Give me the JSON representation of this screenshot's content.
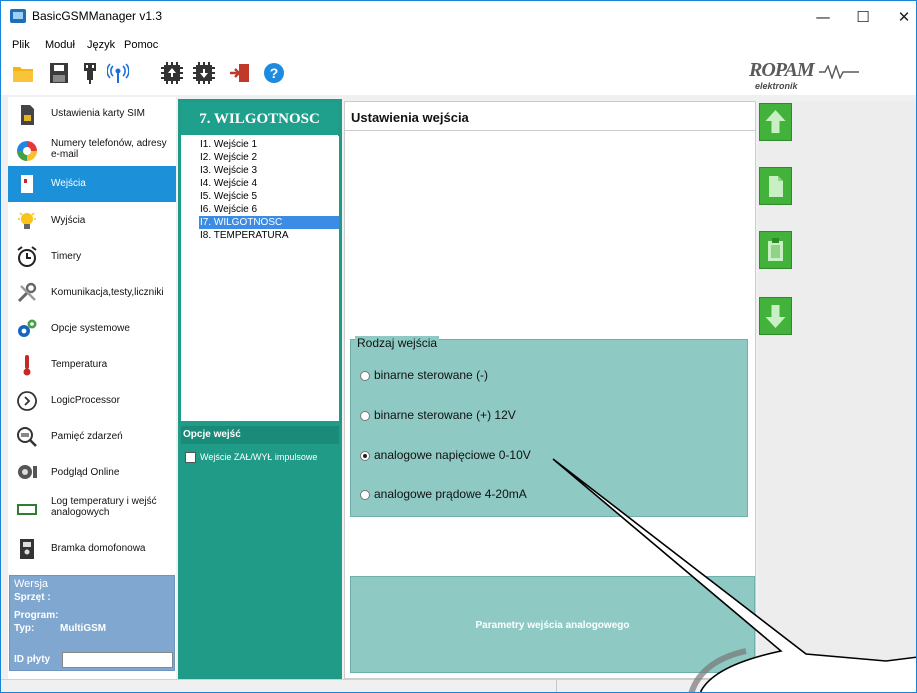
{
  "window": {
    "title": "BasicGSMManager v1.3",
    "controls": [
      "—",
      "☐",
      "✕"
    ]
  },
  "menu": [
    "Plik",
    "Moduł",
    "Język",
    "Pomoc"
  ],
  "toolbar": {
    "icons": [
      "folder-open-icon",
      "save-icon",
      "usb-plug-icon",
      "antenna-icon",
      "chip-upload-icon",
      "chip-download-icon",
      "exit-door-icon",
      "help-icon"
    ],
    "help_glyph": "?",
    "logo_main": "ROPAM",
    "logo_sub": "elektronik"
  },
  "sidebar": {
    "items": [
      {
        "label": "Ustawienia karty SIM",
        "icon": "sim-card-icon",
        "active": false
      },
      {
        "label": "Numery telefonów, adresy e-mail",
        "icon": "contacts-icon",
        "active": false
      },
      {
        "label": "Wejścia",
        "icon": "input-icon",
        "active": true
      },
      {
        "label": "Wyjścia",
        "icon": "bulb-icon",
        "active": false
      },
      {
        "label": "Timery",
        "icon": "alarm-clock-icon",
        "active": false
      },
      {
        "label": "Komunikacja,testy,liczniki",
        "icon": "tools-icon",
        "active": false
      },
      {
        "label": "Opcje systemowe",
        "icon": "gears-icon",
        "active": false
      },
      {
        "label": "Temperatura",
        "icon": "thermometer-icon",
        "active": false
      },
      {
        "label": "LogicProcessor",
        "icon": "brain-icon",
        "active": false
      },
      {
        "label": "Pamięć zdarzeń",
        "icon": "event-memory-icon",
        "active": false
      },
      {
        "label": "Podgląd Online",
        "icon": "online-preview-icon",
        "active": false
      },
      {
        "label": "Log temperatury i wejść analogowych",
        "icon": "log-icon",
        "active": false
      },
      {
        "label": "Bramka domofonowa",
        "icon": "intercom-icon",
        "active": false
      }
    ],
    "version": {
      "legend": "Wersja",
      "hardware_label": "Sprzęt :",
      "program_label": "Program:",
      "type_label": "Typ:",
      "type_value": "MultiGSM",
      "board_id_label": "ID płyty",
      "board_id_value": ""
    }
  },
  "inputs_panel": {
    "header": "7. WILGOTNOSC",
    "items": [
      "I1. Wejście 1",
      "I2. Wejście 2",
      "I3. Wejście 3",
      "I4. Wejście 4",
      "I5. Wejście 5",
      "I6. Wejście 6",
      "I7. WILGOTNOSC",
      "I8. TEMPERATURA"
    ],
    "selected_index": 6,
    "options_header": "Opcje wejść",
    "impulse_checkbox": {
      "label": "Wejście ZAŁ/WYŁ impulsowe",
      "checked": false
    }
  },
  "settings": {
    "title": "Ustawienia wejścia",
    "input_type": {
      "legend": "Rodzaj wejścia",
      "options": [
        "binarne sterowane (-)",
        "binarne sterowane (+) 12V",
        "analogowe napięciowe 0-10V",
        "analogowe prądowe 4-20mA"
      ],
      "selected_index": 2
    },
    "analog_params_button": "Parametry wejścia analogowego"
  },
  "right_buttons": [
    "move-up-icon",
    "copy-icon",
    "paste-icon",
    "move-down-icon"
  ],
  "colors": {
    "accent_blue": "#1c90d8",
    "panel_teal": "#1f9b88",
    "fieldset_teal": "#8ec9c3",
    "action_green": "#43b23a"
  }
}
